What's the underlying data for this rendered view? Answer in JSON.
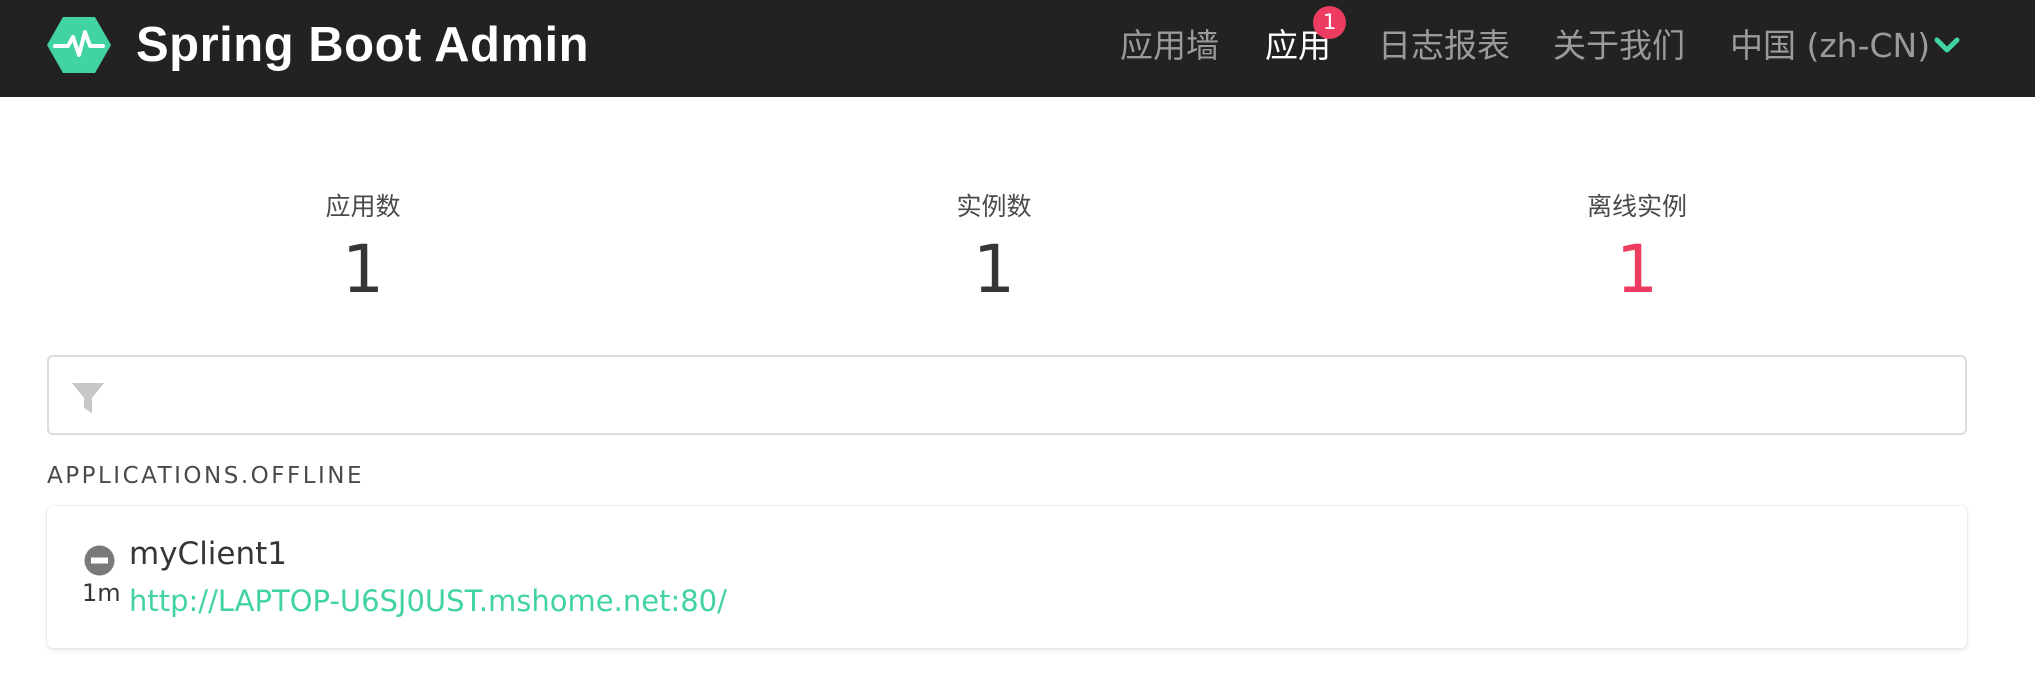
{
  "navbar": {
    "brand_title": "Spring Boot Admin",
    "items": [
      {
        "label": "应用墙",
        "active": false
      },
      {
        "label": "应用",
        "active": true,
        "badge": "1"
      },
      {
        "label": "日志报表",
        "active": false
      },
      {
        "label": "关于我们",
        "active": false
      }
    ],
    "language": "中国 (zh-CN)",
    "colors": {
      "background": "#222222",
      "brand": "#42d3a5",
      "badge": "#ee3c61"
    }
  },
  "stats": {
    "applications": {
      "label": "应用数",
      "value": "1"
    },
    "instances": {
      "label": "实例数",
      "value": "1"
    },
    "offline": {
      "label": "离线实例",
      "value": "1",
      "color": "#ee3c61"
    }
  },
  "filter": {
    "placeholder": "",
    "icon": "filter-icon"
  },
  "section": {
    "heading": "APPLICATIONS.OFFLINE"
  },
  "applications": [
    {
      "name": "myClient1",
      "status_icon": "minus-circle-icon",
      "age": "1m",
      "url": "http://LAPTOP-U6SJ0UST.mshome.net:80/"
    }
  ]
}
